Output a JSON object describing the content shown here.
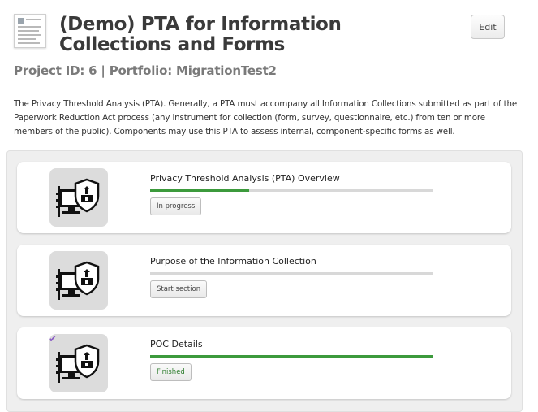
{
  "header": {
    "title": "(Demo) PTA for Information Collections and Forms",
    "subtitle": "Project ID: 6 | Portfolio: MigrationTest2",
    "edit_label": "Edit"
  },
  "description": "The Privacy Threshold Analysis (PTA). Generally, a PTA must accompany all Information Collections submitted as part of the Paperwork Reduction Act process (any instrument for collection (form, survey, questionnaire, etc.) from ten or more members of the public). Components may use this PTA to assess internal, component-specific forms as well.",
  "sections": [
    {
      "title": "Privacy Threshold Analysis (PTA) Overview",
      "progress": 0.35,
      "status": "In progress",
      "completed": false,
      "icon": "privacy-computer-icon"
    },
    {
      "title": "Purpose of the Information Collection",
      "progress": 0.0,
      "status": "Start section",
      "completed": false,
      "icon": "privacy-computer-icon"
    },
    {
      "title": "POC Details",
      "progress": 1.0,
      "status": "Finished",
      "completed": true,
      "icon": "privacy-computer-icon"
    }
  ],
  "colors": {
    "progress": "#3c9a3c",
    "check": "#8a5cc5"
  }
}
